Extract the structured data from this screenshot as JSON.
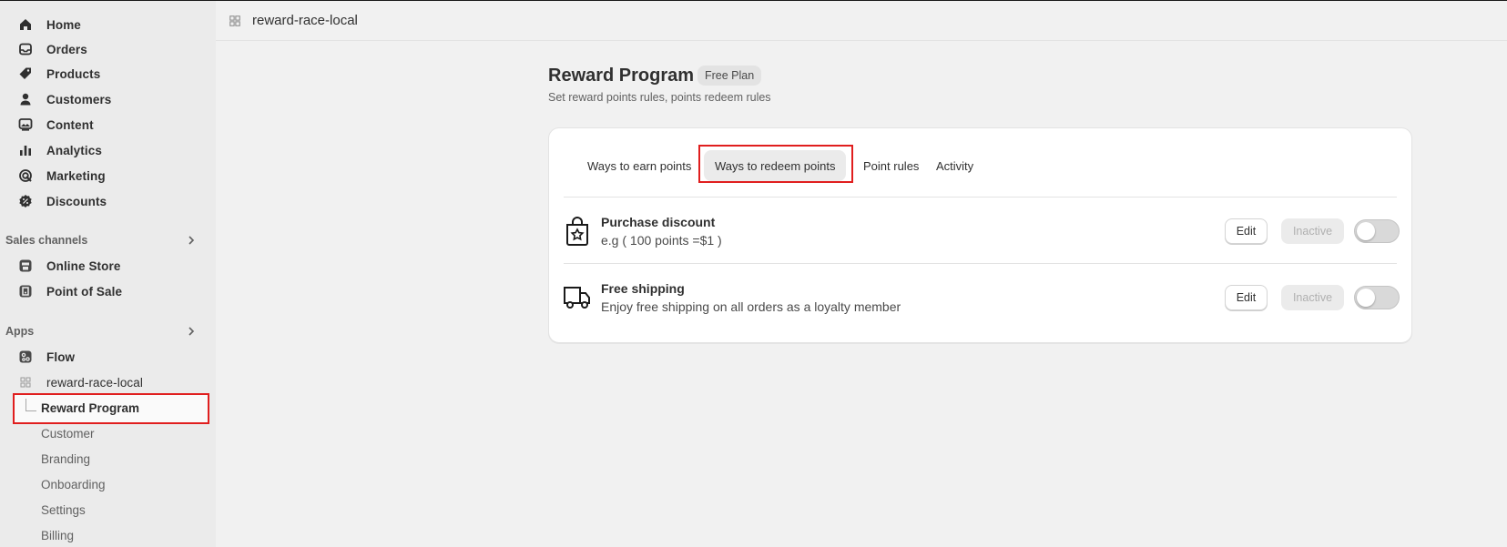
{
  "sidebar": {
    "nav": [
      {
        "label": "Home",
        "icon": "home-icon"
      },
      {
        "label": "Orders",
        "icon": "inbox-icon"
      },
      {
        "label": "Products",
        "icon": "tag-icon"
      },
      {
        "label": "Customers",
        "icon": "person-icon"
      },
      {
        "label": "Content",
        "icon": "image-icon"
      },
      {
        "label": "Analytics",
        "icon": "bar-chart-icon"
      },
      {
        "label": "Marketing",
        "icon": "target-icon"
      },
      {
        "label": "Discounts",
        "icon": "discount-icon"
      }
    ],
    "sales_channels": {
      "title": "Sales channels",
      "items": [
        {
          "label": "Online Store",
          "icon": "store-icon"
        },
        {
          "label": "Point of Sale",
          "icon": "pos-icon"
        }
      ]
    },
    "apps": {
      "title": "Apps",
      "items": [
        {
          "label": "Flow",
          "icon": "flow-icon"
        },
        {
          "label": "reward-race-local",
          "icon": "app-grid-icon"
        }
      ],
      "active_sub": "Reward Program",
      "sub_items": [
        "Customer",
        "Branding",
        "Onboarding",
        "Settings",
        "Billing"
      ]
    }
  },
  "topbar": {
    "app_name": "reward-race-local"
  },
  "page": {
    "title": "Reward Program",
    "badge": "Free Plan",
    "subtitle": "Set reward points rules, points redeem rules"
  },
  "tabs": [
    {
      "label": "Ways to earn points",
      "selected": false
    },
    {
      "label": "Ways to redeem points",
      "selected": true
    },
    {
      "label": "Point rules",
      "selected": false
    },
    {
      "label": "Activity",
      "selected": false
    }
  ],
  "rows": [
    {
      "title": "Purchase discount",
      "desc": "e.g ( 100 points =$1 )",
      "icon": "shopping-bag-star-icon",
      "edit": "Edit",
      "status": "Inactive",
      "enabled": false
    },
    {
      "title": "Free shipping",
      "desc": "Enjoy free shipping on all orders as a loyalty member",
      "icon": "truck-icon",
      "edit": "Edit",
      "status": "Inactive",
      "enabled": false
    }
  ]
}
